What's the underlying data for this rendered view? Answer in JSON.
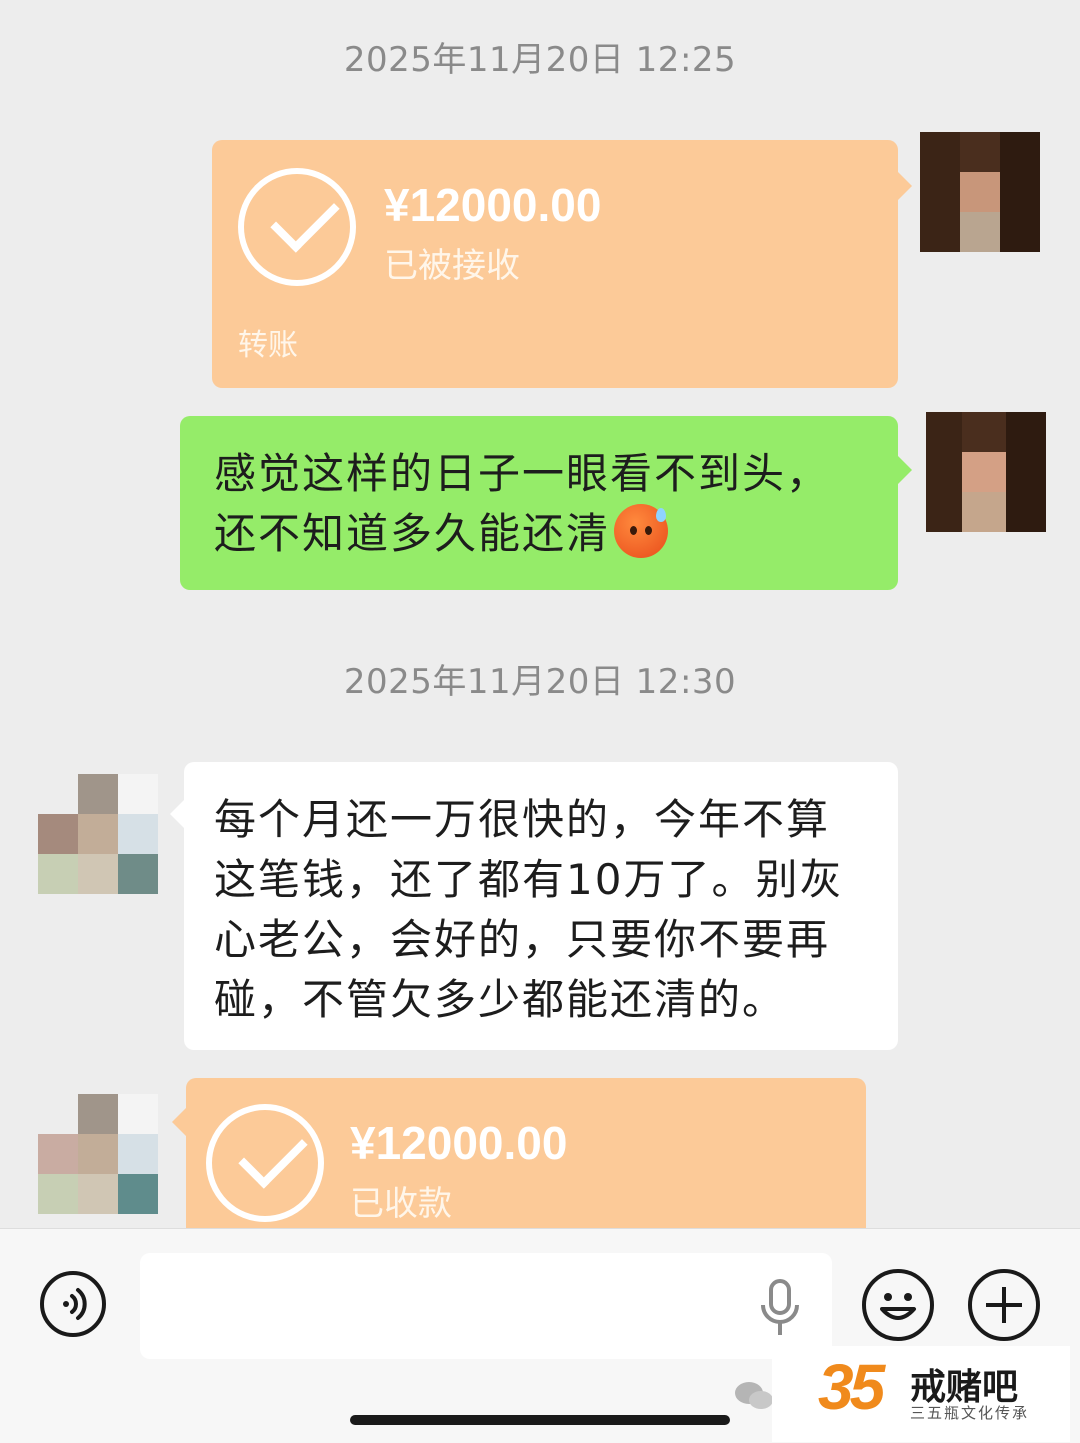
{
  "chat": {
    "timestamp_1": "2025年11月20日 12:25",
    "timestamp_2": "2025年11月20日 12:30",
    "transfer_sent": {
      "amount": "¥12000.00",
      "status": "已被接收",
      "label": "转账"
    },
    "message_sent": {
      "line1": "感觉这样的日子一眼看不到头，",
      "line2": "还不知道多久能还清",
      "emoji": "hot-face-emoji"
    },
    "message_received": {
      "line1": "每个月还一万很快的，今年不算",
      "line2": "这笔钱，还了都有10万了。别灰",
      "line3": "心老公，会好的，只要你不要再",
      "line4": "碰，不管欠多少都能还清的。"
    },
    "transfer_received": {
      "amount": "¥12000.00",
      "status": "已收款"
    }
  },
  "input_bar": {
    "placeholder": "",
    "voice_icon": "voice-icon",
    "mic_icon": "microphone-icon",
    "emoji_icon": "smiley-icon",
    "plus_icon": "plus-icon"
  },
  "watermark": {
    "logo_number": "35",
    "title": "戒赌吧",
    "subtitle": "三五瓶文化传承"
  },
  "colors": {
    "background": "#ededed",
    "transfer_bubble": "#fcca98",
    "sent_bubble": "#95ec69",
    "received_bubble": "#ffffff"
  }
}
